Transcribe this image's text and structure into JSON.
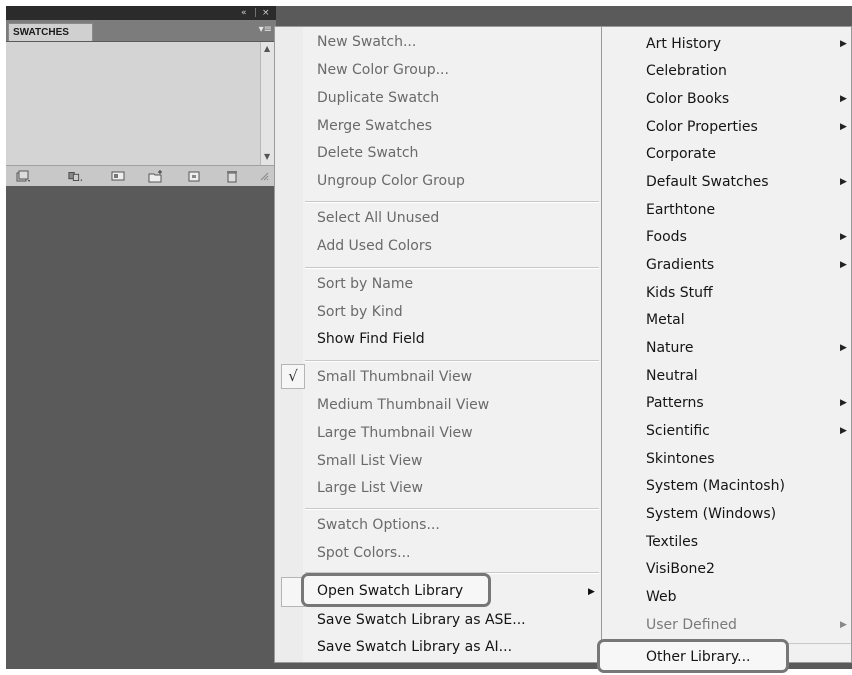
{
  "panel": {
    "tab_label": "SWATCHES",
    "collapse_glyph": "«",
    "close_glyph": "×",
    "menu_glyph": "▾≡",
    "bottom_buttons": [
      {
        "icon": "swatch-libraries-menu-icon"
      },
      {
        "icon": "show-swatch-kinds-icon"
      },
      {
        "icon": "swatch-options-icon"
      },
      {
        "icon": "new-color-group-icon"
      },
      {
        "icon": "new-swatch-icon"
      },
      {
        "icon": "delete-swatch-icon"
      }
    ]
  },
  "menu": {
    "items": [
      {
        "label": "New Swatch...",
        "enabled": false
      },
      {
        "label": "New Color Group...",
        "enabled": false
      },
      {
        "label": "Duplicate Swatch",
        "enabled": false
      },
      {
        "label": "Merge Swatches",
        "enabled": false
      },
      {
        "label": "Delete Swatch",
        "enabled": false
      },
      {
        "label": "Ungroup Color Group",
        "enabled": false
      },
      {
        "label": "Select All Unused",
        "enabled": false
      },
      {
        "label": "Add Used Colors",
        "enabled": false
      },
      {
        "label": "Sort by Name",
        "enabled": false
      },
      {
        "label": "Sort by Kind",
        "enabled": false
      },
      {
        "label": "Show Find Field",
        "enabled": true
      },
      {
        "label": "Small Thumbnail View",
        "enabled": false,
        "checked": true
      },
      {
        "label": "Medium Thumbnail View",
        "enabled": false
      },
      {
        "label": "Large Thumbnail View",
        "enabled": false
      },
      {
        "label": "Small List View",
        "enabled": false
      },
      {
        "label": "Large List View",
        "enabled": false
      },
      {
        "label": "Swatch Options...",
        "enabled": false
      },
      {
        "label": "Spot Colors...",
        "enabled": false
      },
      {
        "label": "Open Swatch Library",
        "enabled": true,
        "submenu": true
      },
      {
        "label": "Save Swatch Library as ASE...",
        "enabled": true
      },
      {
        "label": "Save Swatch Library as AI...",
        "enabled": true
      }
    ],
    "check_glyph": "√"
  },
  "submenu": {
    "items": [
      {
        "label": "Art History",
        "arrow": true
      },
      {
        "label": "Celebration",
        "arrow": false
      },
      {
        "label": "Color Books",
        "arrow": true
      },
      {
        "label": "Color Properties",
        "arrow": true
      },
      {
        "label": "Corporate",
        "arrow": false
      },
      {
        "label": "Default Swatches",
        "arrow": true
      },
      {
        "label": "Earthtone",
        "arrow": false
      },
      {
        "label": "Foods",
        "arrow": true
      },
      {
        "label": "Gradients",
        "arrow": true
      },
      {
        "label": "Kids Stuff",
        "arrow": false
      },
      {
        "label": "Metal",
        "arrow": false
      },
      {
        "label": "Nature",
        "arrow": true
      },
      {
        "label": "Neutral",
        "arrow": false
      },
      {
        "label": "Patterns",
        "arrow": true
      },
      {
        "label": "Scientific",
        "arrow": true
      },
      {
        "label": "Skintones",
        "arrow": false
      },
      {
        "label": "System (Macintosh)",
        "arrow": false
      },
      {
        "label": "System (Windows)",
        "arrow": false
      },
      {
        "label": "Textiles",
        "arrow": false
      },
      {
        "label": "VisiBone2",
        "arrow": false
      },
      {
        "label": "Web",
        "arrow": false
      },
      {
        "label": "User Defined",
        "arrow": true,
        "enabled": false
      },
      {
        "label": "Other Library...",
        "arrow": false
      }
    ],
    "arrow_glyph": "▸"
  },
  "colors": {
    "workspace": "#5a5a5a",
    "menu_bg": "#f1f1f1",
    "highlight_border": "#777777"
  }
}
